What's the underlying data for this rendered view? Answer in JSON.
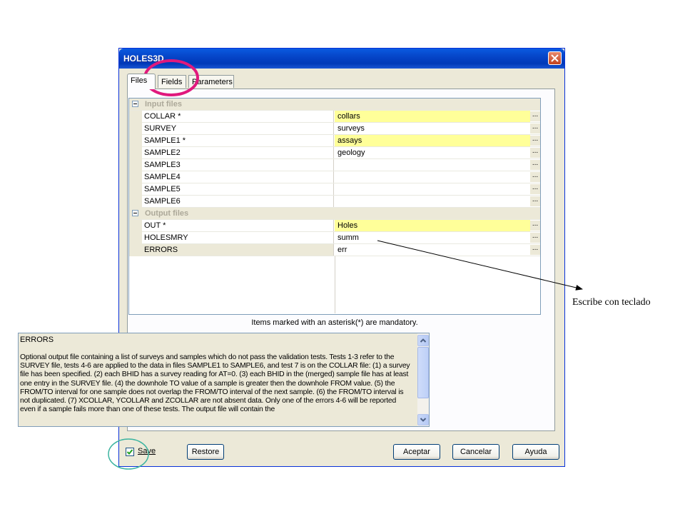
{
  "window": {
    "title": "HOLES3D"
  },
  "tabs": [
    {
      "label": "Files",
      "active": true
    },
    {
      "label": "Fields",
      "active": false
    },
    {
      "label": "Parameters",
      "active": false
    }
  ],
  "grid": {
    "categories": [
      {
        "label": "Input files",
        "rows": [
          {
            "name": "COLLAR *",
            "value": "collars",
            "mandatory": true
          },
          {
            "name": "SURVEY",
            "value": "surveys",
            "mandatory": false
          },
          {
            "name": "SAMPLE1 *",
            "value": "assays",
            "mandatory": true
          },
          {
            "name": "SAMPLE2",
            "value": "geology",
            "mandatory": false
          },
          {
            "name": "SAMPLE3",
            "value": "",
            "mandatory": false
          },
          {
            "name": "SAMPLE4",
            "value": "",
            "mandatory": false
          },
          {
            "name": "SAMPLE5",
            "value": "",
            "mandatory": false
          },
          {
            "name": "SAMPLE6",
            "value": "",
            "mandatory": false
          }
        ]
      },
      {
        "label": "Output files",
        "rows": [
          {
            "name": "OUT *",
            "value": "Holes",
            "mandatory": true
          },
          {
            "name": "HOLESMRY",
            "value": "summ",
            "mandatory": false
          },
          {
            "name": "ERRORS",
            "value": "err",
            "mandatory": false
          }
        ]
      }
    ],
    "browse_label": "...",
    "mandatory_color": "#ffff99"
  },
  "note": "Items marked with an asterisk(*) are mandatory.",
  "description": {
    "title": "ERRORS",
    "body": "Optional output file containing a list of surveys and samples which do not pass the validation tests. Tests 1-3 refer to the SURVEY file, tests 4-6 are applied to the data in files SAMPLE1 to SAMPLE6, and test 7 is on the COLLAR file: (1) a survey file has been specified. (2) each BHID has a survey reading for AT=0. (3) each BHID in the (merged) sample file has at least one entry in the SURVEY file. (4) the downhole TO value of a sample is greater then the downhole FROM value. (5) the FROM/TO interval for one sample does not overlap the FROM/TO interval of the next sample. (6) the FROM/TO interval is not duplicated. (7) XCOLLAR, YCOLLAR and ZCOLLAR are not absent data. Only one of the errors 4-6 will be reported even if a sample fails more than one of these tests. The output file will contain the"
  },
  "footer": {
    "save_label": "Save",
    "save_checked": true,
    "restore_label": "Restore",
    "ok_label": "Aceptar",
    "cancel_label": "Cancelar",
    "help_label": "Ayuda"
  },
  "annotation": {
    "callout_text": "Escribe con teclado",
    "highlight_color": "#e0197d",
    "save_circle_color": "#3cb4a0"
  }
}
